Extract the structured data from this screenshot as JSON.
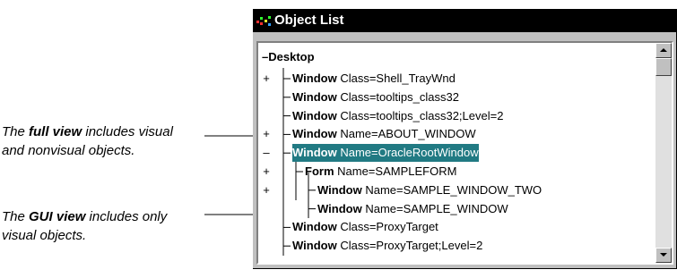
{
  "window": {
    "title": "Object List"
  },
  "tree": {
    "root": "Desktop",
    "rows": [
      {
        "expander": "+",
        "kind": "Window",
        "props": "Class=Shell_TrayWnd"
      },
      {
        "expander": "",
        "kind": "Window",
        "props": "Class=tooltips_class32"
      },
      {
        "expander": "",
        "kind": "Window",
        "props": "Class=tooltips_class32;Level=2"
      },
      {
        "expander": "+",
        "kind": "Window",
        "props": "Name=ABOUT_WINDOW"
      },
      {
        "expander": "–",
        "kind": "Window",
        "props": "Name=OracleRootWindow",
        "selected": true
      },
      {
        "expander": "+",
        "kind": "Form",
        "props": "Name=SAMPLEFORM"
      },
      {
        "expander": "+",
        "kind": "Window",
        "props": "Name=SAMPLE_WINDOW_TWO"
      },
      {
        "expander": "",
        "kind": "Window",
        "props": "Name=SAMPLE_WINDOW"
      },
      {
        "expander": "",
        "kind": "Window",
        "props": "Class=ProxyTarget"
      },
      {
        "expander": "",
        "kind": "Window",
        "props": "Class=ProxyTarget;Level=2"
      }
    ]
  },
  "callouts": {
    "full": {
      "pre": "The ",
      "bold": "full view",
      "post": " includes visual and nonvisual objects."
    },
    "gui": {
      "pre": "The ",
      "bold": "GUI view",
      "post": " includes only visual objects."
    }
  },
  "colors": {
    "selection": "#217a83",
    "titlebar": "#000000"
  }
}
